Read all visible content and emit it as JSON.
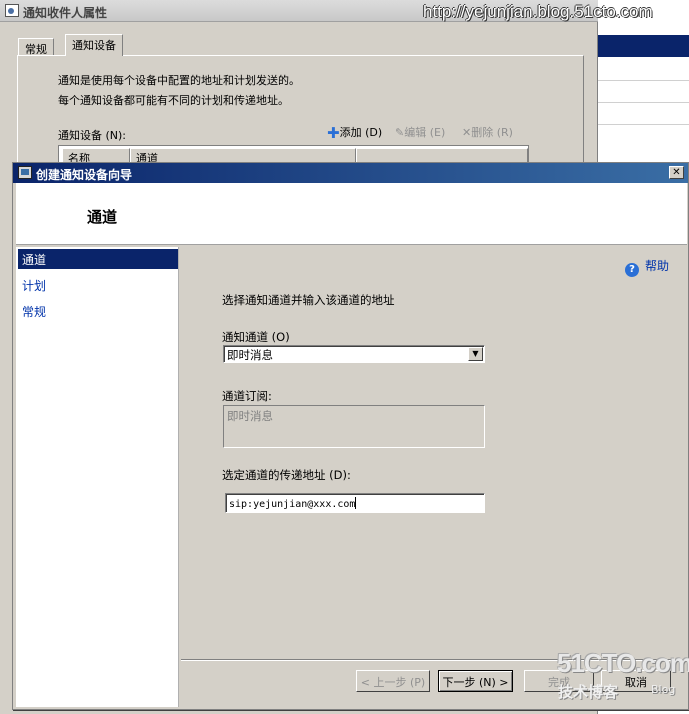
{
  "background_dialog": {
    "title": "通知收件人属性",
    "tabs": [
      "常规",
      "通知设备"
    ],
    "desc_line1": "通知是使用每个设备中配置的地址和计划发送的。",
    "desc_line2": "每个通知设备都可能有不同的计划和传递地址。",
    "devices_label": "通知设备 (N):",
    "add_label": "添加 (D)",
    "edit_label": "编辑 (E)",
    "delete_label": "删除 (R)",
    "columns": [
      "名称",
      "通道"
    ]
  },
  "watermark": {
    "url": "http://yejunjian.blog.51cto.com",
    "brand": "51CTO.com",
    "brand_sub": "技术博客",
    "blog": "Blog"
  },
  "wizard": {
    "title": "创建通知设备向导",
    "header_title": "通道",
    "nav_items": [
      "通道",
      "计划",
      "常规"
    ],
    "help_label": "帮助",
    "instruction": "选择通知通道并输入该通道的地址",
    "channel_label": "通知通道 (O)",
    "channel_value": "即时消息",
    "subscription_label": "通道订阅:",
    "subscription_value": "即时消息",
    "address_label": "选定通道的传递地址 (D):",
    "address_value": "sip:yejunjian@xxx.com",
    "buttons": {
      "back": "< 上一步 (P)",
      "next": "下一步 (N) >",
      "finish": "完成",
      "cancel": "取消"
    }
  },
  "colors": {
    "title_active": "#0a246a",
    "face": "#d4d0c8",
    "link": "#0033aa"
  }
}
